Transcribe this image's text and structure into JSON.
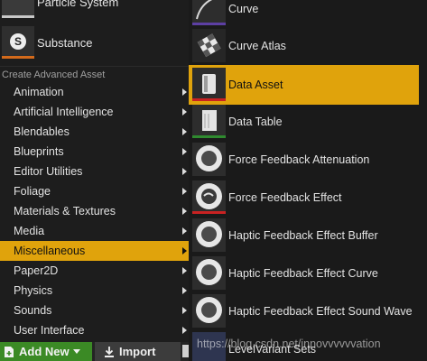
{
  "left_menu": {
    "top_items": [
      {
        "label": "Particle System",
        "icon": "particle-system-icon"
      },
      {
        "label": "Substance",
        "icon": "substance-icon",
        "badge": "S",
        "strip_color": "#d36a1b"
      }
    ],
    "section_header": "Create Advanced Asset",
    "categories": [
      {
        "label": "Animation"
      },
      {
        "label": "Artificial Intelligence"
      },
      {
        "label": "Blendables"
      },
      {
        "label": "Blueprints"
      },
      {
        "label": "Editor Utilities"
      },
      {
        "label": "Foliage"
      },
      {
        "label": "Materials & Textures"
      },
      {
        "label": "Media"
      },
      {
        "label": "Miscellaneous",
        "selected": true
      },
      {
        "label": "Paper2D"
      },
      {
        "label": "Physics"
      },
      {
        "label": "Sounds"
      },
      {
        "label": "User Interface"
      }
    ],
    "selected_color": "#e0a30c"
  },
  "toolbar": {
    "add_new_label": "Add New",
    "import_label": "Import",
    "add_new_color": "#3b8a25"
  },
  "submenu": {
    "items": [
      {
        "label": "Curve",
        "icon": "curve-icon",
        "strip_color": "#5d3fa3"
      },
      {
        "label": "Curve Atlas",
        "icon": "curve-atlas-icon"
      },
      {
        "label": "Data Asset",
        "icon": "data-asset-icon",
        "selected": true,
        "strip_color": "#c92222"
      },
      {
        "label": "Data Table",
        "icon": "data-table-icon",
        "strip_color": "#2f8a2f"
      },
      {
        "label": "Force Feedback Attenuation",
        "icon": "force-feedback-attenuation-icon"
      },
      {
        "label": "Force Feedback Effect",
        "icon": "force-feedback-effect-icon",
        "strip_color": "#c92222"
      },
      {
        "label": "Haptic Feedback Effect Buffer",
        "icon": "haptic-buffer-icon"
      },
      {
        "label": "Haptic Feedback Effect Curve",
        "icon": "haptic-curve-icon"
      },
      {
        "label": "Haptic Feedback Effect Sound Wave",
        "icon": "haptic-sound-wave-icon"
      },
      {
        "label": "LevelVariant Sets",
        "icon": "level-variant-sets-icon",
        "strip_color": "#3d52b8"
      }
    ]
  },
  "watermark": "https://blog.csdn.net/innovvvvvvation"
}
